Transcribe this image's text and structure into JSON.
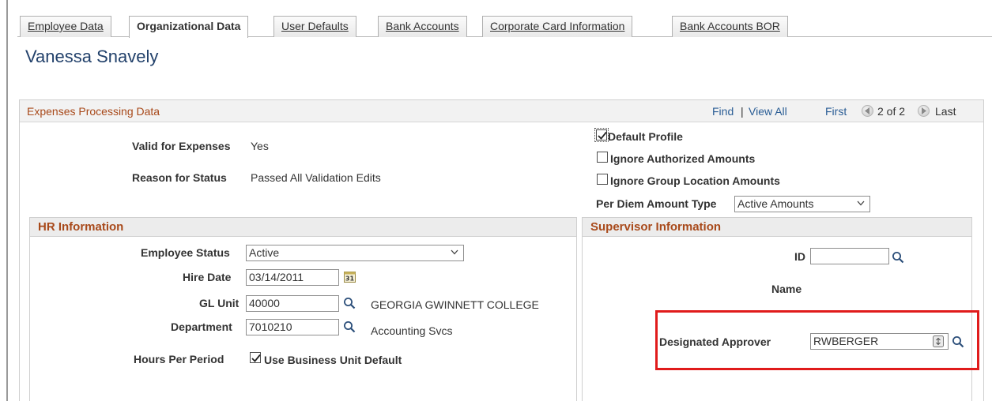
{
  "tabs": [
    {
      "label": "Employee Data",
      "active": false
    },
    {
      "label": "Organizational Data",
      "active": true
    },
    {
      "label": "User Defaults",
      "active": false
    },
    {
      "label": "Bank Accounts",
      "active": false
    },
    {
      "label": "Corporate Card Information",
      "active": false
    },
    {
      "label": "Bank Accounts BOR",
      "active": false
    }
  ],
  "page_title": "Vanessa Snavely",
  "section": {
    "title": "Expenses Processing Data",
    "find": "Find",
    "separator": "|",
    "view_all": "View All",
    "first": "First",
    "position": "2 of 2",
    "last": "Last"
  },
  "status": {
    "valid_label": "Valid for Expenses",
    "valid_value": "Yes",
    "reason_label": "Reason for Status",
    "reason_value": "Passed All Validation Edits"
  },
  "options": {
    "default_profile": {
      "label": "Default Profile",
      "checked": true
    },
    "ignore_authorized": {
      "label": "Ignore Authorized Amounts",
      "checked": false
    },
    "ignore_group_location": {
      "label": "Ignore Group Location Amounts",
      "checked": false
    },
    "per_diem_label": "Per Diem Amount Type",
    "per_diem_value": "Active Amounts"
  },
  "hr": {
    "title": "HR Information",
    "employee_status_label": "Employee Status",
    "employee_status_value": "Active",
    "hire_date_label": "Hire Date",
    "hire_date_value": "03/14/2011",
    "gl_unit_label": "GL Unit",
    "gl_unit_value": "40000",
    "gl_unit_desc": "GEORGIA GWINNETT COLLEGE",
    "department_label": "Department",
    "department_value": "7010210",
    "department_desc": "Accounting Svcs",
    "hours_label": "Hours Per Period",
    "use_bu_default": {
      "label": "Use Business Unit Default",
      "checked": true
    }
  },
  "supervisor": {
    "title": "Supervisor Information",
    "id_label": "ID",
    "id_value": "",
    "name_label": "Name",
    "approver_label": "Designated Approver",
    "approver_value": "RWBERGER"
  },
  "colors": {
    "section_title": "#a8491a",
    "link": "#2a5d95",
    "page_title": "#22416b",
    "highlight": "#e01b1b"
  }
}
